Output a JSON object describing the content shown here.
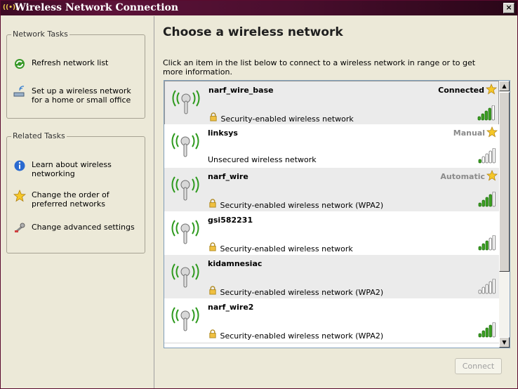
{
  "window": {
    "title": "Wireless Network Connection",
    "close_label": "×"
  },
  "left": {
    "network_tasks": {
      "title": "Network Tasks",
      "items": [
        {
          "label": "Refresh network list",
          "icon": "refresh-icon"
        },
        {
          "label": "Set up a wireless network for a home or small office",
          "icon": "wireless-setup-icon"
        }
      ]
    },
    "related_tasks": {
      "title": "Related Tasks",
      "items": [
        {
          "label": "Learn about wireless networking",
          "icon": "info-icon"
        },
        {
          "label": "Change the order of preferred networks",
          "icon": "star-icon"
        },
        {
          "label": "Change advanced settings",
          "icon": "wrench-icon"
        }
      ]
    }
  },
  "main": {
    "heading": "Choose a wireless network",
    "instructions": "Click an item in the list below to connect to a wireless network in range or to get more information.",
    "networks": [
      {
        "ssid": "narf_wire_base",
        "security": "Security-enabled wireless network",
        "secured": true,
        "status": "Connected",
        "signal_bars": 4,
        "preferred": true
      },
      {
        "ssid": "linksys",
        "security": "Unsecured wireless network",
        "secured": false,
        "status": "Manual",
        "signal_bars": 1,
        "preferred": true
      },
      {
        "ssid": "narf_wire",
        "security": "Security-enabled wireless network (WPA2)",
        "secured": true,
        "status": "Automatic",
        "signal_bars": 4,
        "preferred": true
      },
      {
        "ssid": "gsi582231",
        "security": "Security-enabled wireless network",
        "secured": true,
        "status": "",
        "signal_bars": 3,
        "preferred": false
      },
      {
        "ssid": "kidamnesiac",
        "security": "Security-enabled wireless network (WPA2)",
        "secured": true,
        "status": "",
        "signal_bars": 0,
        "preferred": false
      },
      {
        "ssid": "narf_wire2",
        "security": "Security-enabled wireless network (WPA2)",
        "secured": true,
        "status": "",
        "signal_bars": 4,
        "preferred": false
      }
    ],
    "connect_label": "Connect"
  },
  "colors": {
    "signal_green": "#3aa020",
    "signal_empty": "#ffffff",
    "wave_green": "#2e9a1e",
    "titlebar": "#4a0e2e"
  }
}
